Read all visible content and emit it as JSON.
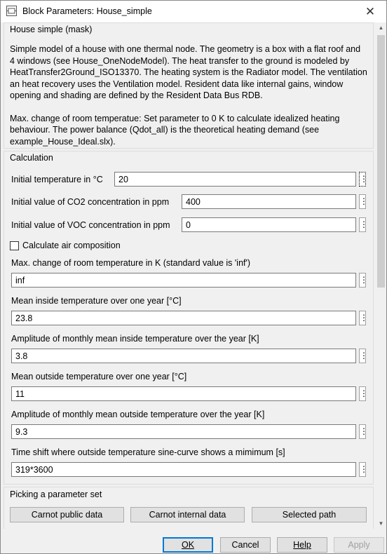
{
  "window": {
    "title": "Block Parameters: House_simple",
    "close": "✕"
  },
  "mask": {
    "title": "House simple (mask)",
    "description": [
      "Simple model of a house with one thermal node. The geometry is a box with a flat roof and 4 windows (see House_OneNodeModel). The heat transfer to the ground is modeled by HeatTransfer2Ground_ISO13370. The heating system is the Radiator model. The ventilation an heat recovery uses the Ventilation model. Resident data like internal gains, window opening and shading are defined by the Resident Data Bus RDB.",
      "Max. change of room temperatue: Set parameter to 0 K to calculate idealized heating behaviour. The power balance (Qdot_all) is the theoretical heating demand (see example_House_Ideal.slx)."
    ]
  },
  "calculation": {
    "title": "Calculation",
    "initial_temperature": {
      "label": "Initial temperature in °C",
      "value": "20"
    },
    "initial_co2": {
      "label": "Initial value of CO2 concentration in ppm",
      "value": "400"
    },
    "initial_voc": {
      "label": "Initial value of VOC concentration in ppm",
      "value": "0"
    },
    "air_composition": {
      "label": "Calculate air composition",
      "checked": false
    },
    "max_change": {
      "label": "Max. change of room temperature in K (standard value is 'inf')",
      "value": "inf"
    },
    "mean_inside": {
      "label": "Mean inside temperature over one year [°C]",
      "value": "23.8"
    },
    "amp_inside": {
      "label": "Amplitude of monthly mean inside temperature over the year [K]",
      "value": "3.8"
    },
    "mean_outside": {
      "label": "Mean outside temperature over one year [°C]",
      "value": "11"
    },
    "amp_outside": {
      "label": "Amplitude of monthly mean outside temperature over the year [K]",
      "value": "9.3"
    },
    "time_shift": {
      "label": "Time shift where outside temperature sine-curve shows a mimimum [s]",
      "value": "319*3600"
    },
    "dots": "⋮"
  },
  "picking": {
    "title": "Picking a parameter set",
    "buttons": [
      "Carnot public data",
      "Carnot internal data",
      "Selected path"
    ]
  },
  "footer": {
    "ok": "OK",
    "cancel": "Cancel",
    "help": "Help",
    "apply": "Apply"
  },
  "scrollbar": {
    "up": "▲",
    "down": "▼"
  }
}
